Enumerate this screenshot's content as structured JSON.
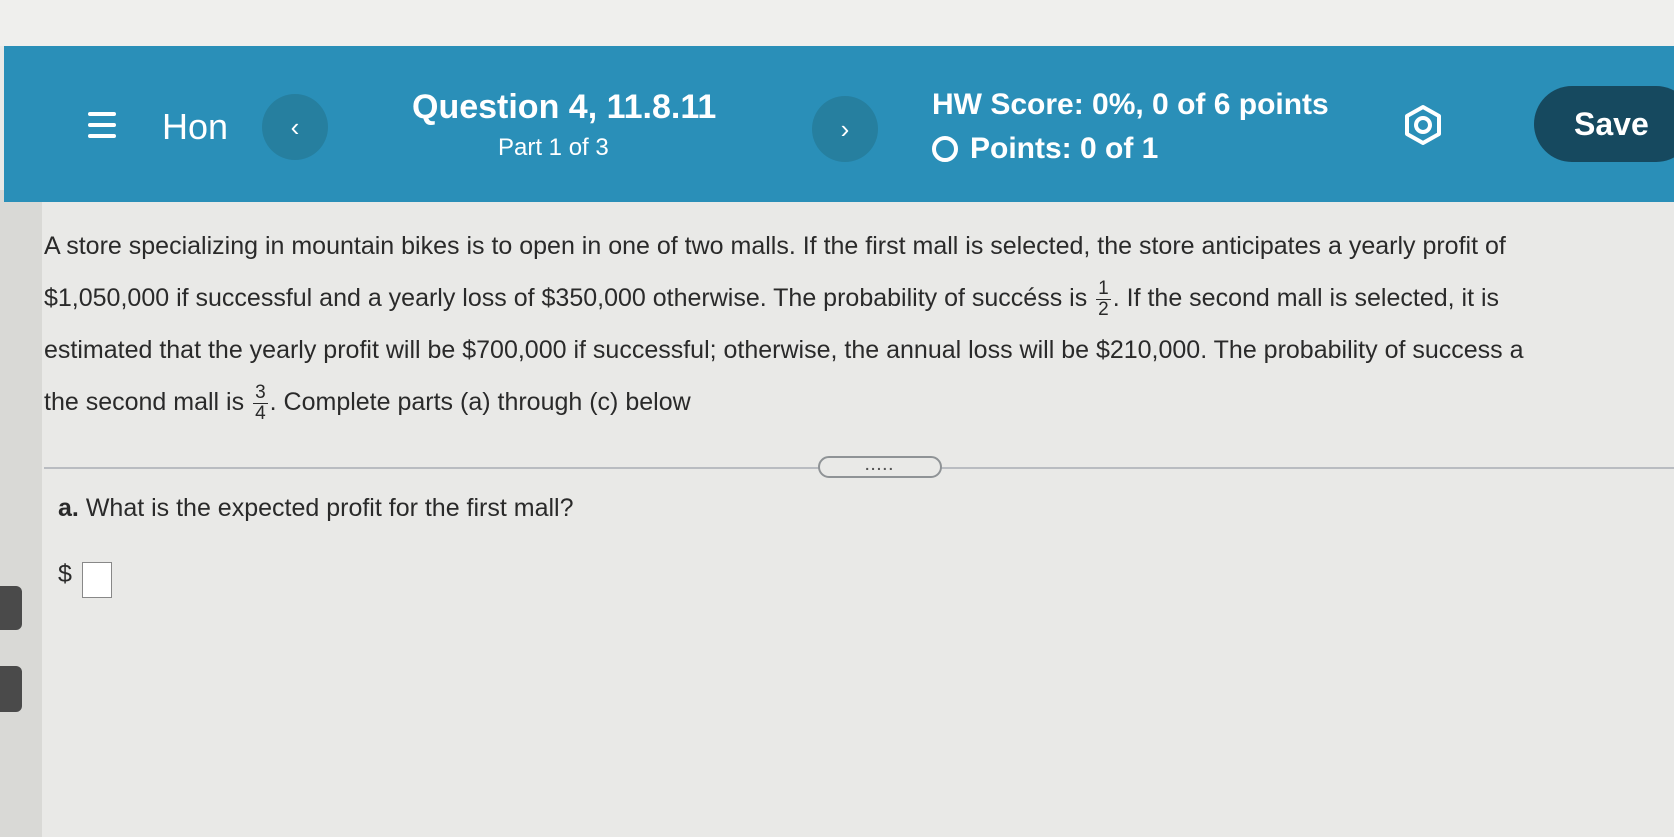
{
  "header": {
    "menu_icon": "hamburger-menu-icon",
    "home_label": "Hon",
    "prev_glyph": "‹",
    "next_glyph": "›",
    "question_title": "Question 4, 11.8.11",
    "question_part": "Part 1 of 3",
    "hw_score": "HW Score: 0%, 0 of 6 points",
    "points": "Points: 0 of 1",
    "settings_icon": "gear-icon",
    "save_label": "Save"
  },
  "question": {
    "line1": "A store specializing in mountain bikes is to open in one of two malls. If the first mall is selected, the store anticipates a yearly profit of",
    "line2_a": "$1,050,000 if successful and a yearly loss of $350,000 otherwise. The probability of succéss is",
    "frac1_num": "1",
    "frac1_den": "2",
    "line2_b": ". If the second mall is selected, it is",
    "line3": "estimated that the yearly profit will be $700,000 if successful; otherwise, the annual loss will be $210,000. The probability of success a",
    "line4_a": "the second mall is",
    "frac2_num": "3",
    "frac2_den": "4",
    "line4_b": ". Complete parts (a) through (c) below"
  },
  "expander": ".....",
  "part_a": {
    "label": "a.",
    "text": "What is the expected profit for the first mall?",
    "currency": "$",
    "answer_value": ""
  },
  "colors": {
    "header_bg": "#2a8fb8",
    "save_bg": "#16495f",
    "page_bg": "#e9e9e7"
  }
}
